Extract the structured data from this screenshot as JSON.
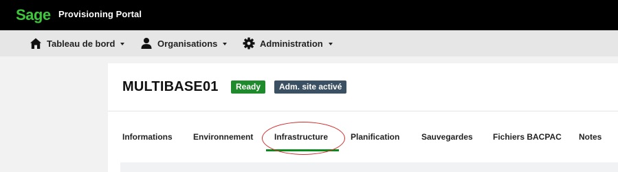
{
  "app": {
    "logo_text": "Sage",
    "title": "Provisioning Portal",
    "brand_color": "#3ec73c"
  },
  "nav": {
    "items": [
      {
        "label": "Tableau de bord",
        "icon": "home-icon"
      },
      {
        "label": "Organisations",
        "icon": "user-icon"
      },
      {
        "label": "Administration",
        "icon": "gear-icon"
      }
    ]
  },
  "site": {
    "name": "MULTIBASE01",
    "badges": [
      {
        "label": "Ready",
        "color": "#1f8a2b"
      },
      {
        "label": "Adm. site activé",
        "color": "#3b5062"
      }
    ]
  },
  "tabs": {
    "items": [
      {
        "label": "Informations"
      },
      {
        "label": "Environnement"
      },
      {
        "label": "Infrastructure",
        "active": true
      },
      {
        "label": "Planification"
      },
      {
        "label": "Sauvegardes"
      },
      {
        "label": "Fichiers BACPAC"
      },
      {
        "label": "Notes"
      }
    ],
    "active_color": "#0b8a1f",
    "annotation_color": "#d42a2a"
  }
}
